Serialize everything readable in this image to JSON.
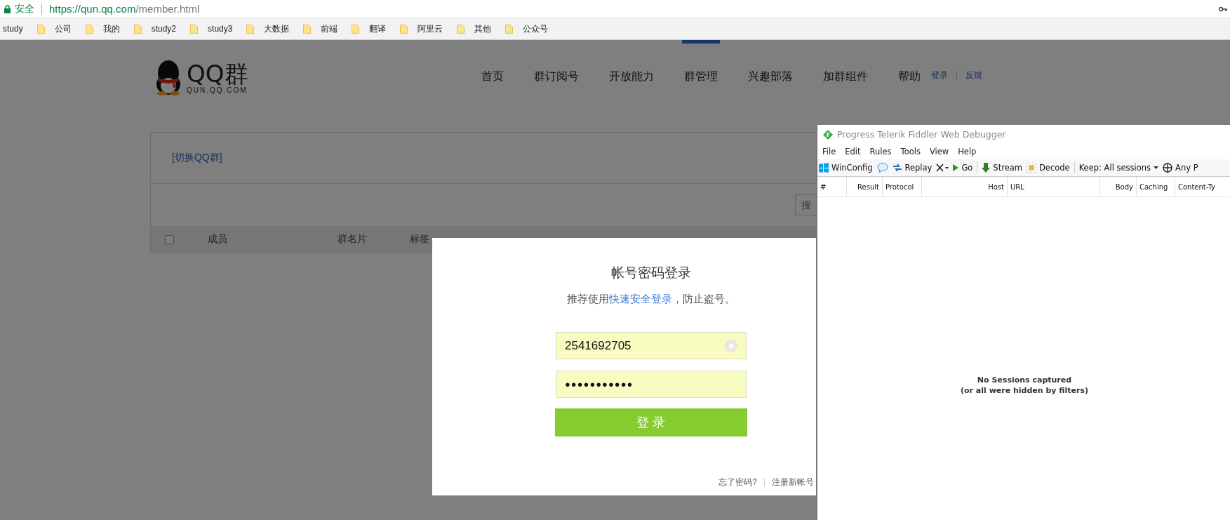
{
  "browser": {
    "secure_label": "安全",
    "url_host": "https://qun.qq.com",
    "url_path": "/member.html"
  },
  "bookmarks": [
    {
      "label": "study",
      "kind": "page"
    },
    {
      "label": "公司",
      "kind": "folder"
    },
    {
      "label": "我的",
      "kind": "folder"
    },
    {
      "label": "study2",
      "kind": "folder"
    },
    {
      "label": "study3",
      "kind": "folder"
    },
    {
      "label": "大数据",
      "kind": "folder"
    },
    {
      "label": "前端",
      "kind": "folder"
    },
    {
      "label": "翻译",
      "kind": "folder"
    },
    {
      "label": "阿里云",
      "kind": "folder"
    },
    {
      "label": "其他",
      "kind": "folder"
    },
    {
      "label": "公众号",
      "kind": "folder"
    }
  ],
  "site": {
    "logo_text": "QQ群",
    "logo_subtext": "QUN.QQ.COM",
    "nav": [
      {
        "label": "首页",
        "selected": false
      },
      {
        "label": "群订阅号",
        "selected": false
      },
      {
        "label": "开放能力",
        "selected": false
      },
      {
        "label": "群管理",
        "selected": true
      },
      {
        "label": "兴趣部落",
        "selected": false
      },
      {
        "label": "加群组件",
        "selected": false
      },
      {
        "label": "帮助",
        "selected": false
      }
    ],
    "login_link": "登录",
    "feedback_link": "反馈"
  },
  "member_panel": {
    "switch_group": "[切换QQ群]",
    "search_placeholder": "搜",
    "select_all_checked": false,
    "columns": [
      "成员",
      "群名片",
      "标签"
    ]
  },
  "login_dialog": {
    "title": "帐号密码登录",
    "hint_before": "推荐使用",
    "hint_link": "快速安全登录",
    "hint_after": "，防止盗号。",
    "account": "2541692705",
    "password": "●●●●●●●●●●●",
    "submit": "登 录",
    "forgot": "忘了密码?",
    "register": "注册新帐号"
  },
  "fiddler": {
    "title": "Progress Telerik Fiddler Web Debugger",
    "menu": [
      "File",
      "Edit",
      "Rules",
      "Tools",
      "View",
      "Help"
    ],
    "toolbar": [
      {
        "kind": "windows",
        "label": "WinConfig"
      },
      {
        "kind": "comment"
      },
      {
        "kind": "replay",
        "label": "Replay"
      },
      {
        "kind": "remove"
      },
      {
        "kind": "go",
        "label": "Go"
      },
      {
        "kind": "separator"
      },
      {
        "kind": "stream",
        "label": "Stream"
      },
      {
        "kind": "decode",
        "label": "Decode"
      },
      {
        "kind": "separator"
      },
      {
        "kind": "dropdown",
        "label": "Keep: All sessions"
      },
      {
        "kind": "target",
        "label": "Any P"
      }
    ],
    "columns": [
      "#",
      "Result",
      "Protocol",
      "Host",
      "URL",
      "Body",
      "Caching",
      "Content-Ty"
    ],
    "empty_message": [
      "No Sessions captured",
      "(or all were hidden by filters)"
    ]
  }
}
